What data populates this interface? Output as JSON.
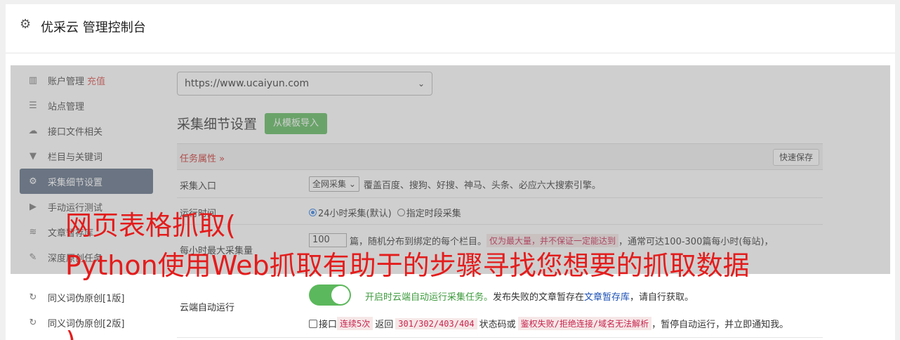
{
  "header": {
    "title": "优采云 管理控制台",
    "icon": "gear-icon"
  },
  "sidebar": {
    "items": [
      {
        "label": "账户管理",
        "extra": "充值",
        "icon": "bar-chart-icon",
        "glyph": "▥"
      },
      {
        "label": "站点管理",
        "icon": "server-icon",
        "glyph": "☰"
      },
      {
        "label": "接口文件相关",
        "icon": "cloud-download-icon",
        "glyph": "☁"
      },
      {
        "label": "栏目与关键词",
        "icon": "filter-icon",
        "glyph": "▼"
      },
      {
        "label": "采集细节设置",
        "icon": "cogs-icon",
        "glyph": "⚙",
        "active": true
      },
      {
        "label": "手动运行测试",
        "icon": "play-circle-icon",
        "glyph": "▶"
      },
      {
        "label": "文章暂存库",
        "icon": "database-icon",
        "glyph": "≋"
      },
      {
        "label": "深度原创任务",
        "icon": "edit-icon",
        "glyph": "✎"
      }
    ],
    "lower_items": [
      {
        "label": "同义词伪原创[1版]",
        "icon": "refresh-icon",
        "glyph": "↻"
      },
      {
        "label": "同义词伪原创[2版]",
        "icon": "refresh-icon",
        "glyph": "↻"
      }
    ]
  },
  "main": {
    "site_select": "https://www.ucaiyun.com",
    "section_title": "采集细节设置",
    "import_button": "从模板导入",
    "task_props": "任务属性 »",
    "quick_save": "快速保存",
    "rows": {
      "entry": {
        "label": "采集入口",
        "select": "全网采集",
        "desc": "覆盖百度、搜狗、好搜、神马、头条、必应六大搜索引擎。"
      },
      "time": {
        "label": "运行时间",
        "opt1": "24小时采集(默认)",
        "opt2": "指定时段采集"
      },
      "max": {
        "label": "每小时最大采集量",
        "value": "100",
        "desc1": "篇，随机分布到绑定的每个栏目。",
        "hl": "仅为最大量，并不保证一定能达到",
        "desc2": "，通常可达100-300篇每小时(每站)，"
      }
    },
    "cloud": {
      "label": "云端自动运行",
      "desc_green": "开启时云端自动运行采集任务。",
      "desc_mid": "发布失败的文章暂存在",
      "desc_link": "文章暂存库",
      "desc_end": "，请自行获取。",
      "chk_label": "接口",
      "hl1": "连续5次",
      "mid1": "返回",
      "hl2": "301/302/403/404",
      "mid2": "状态码或",
      "hl3": "鉴权失败/拒绝连接/域名无法解析",
      "end": "，暂停自动运行，并立即通知我。"
    }
  },
  "watermark": {
    "line1": "网页表格抓取(",
    "line2": "Python使用Web抓取有助于的步骤寻找您想要的抓取数据",
    "line3": ")"
  }
}
